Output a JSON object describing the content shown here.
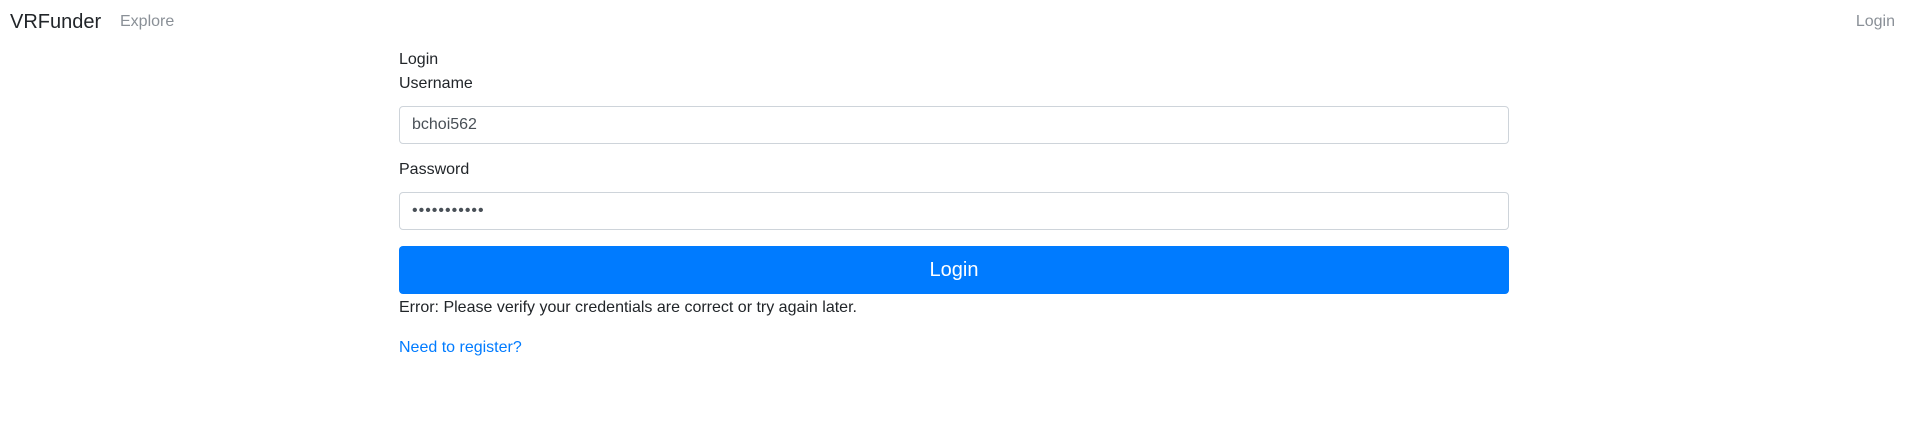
{
  "navbar": {
    "brand": "VRFunder",
    "explore_label": "Explore",
    "login_label": "Login"
  },
  "form": {
    "title": "Login",
    "username_label": "Username",
    "username_value": "bchoi562",
    "password_label": "Password",
    "password_value": "•••••••••••",
    "submit_label": "Login",
    "error_text": "Error: Please verify your credentials are correct or try again later.",
    "register_link": "Need to register?"
  },
  "colors": {
    "primary": "#007bff",
    "nav_muted": "#8a9097",
    "input_border": "#ced4da",
    "text": "#212529"
  }
}
